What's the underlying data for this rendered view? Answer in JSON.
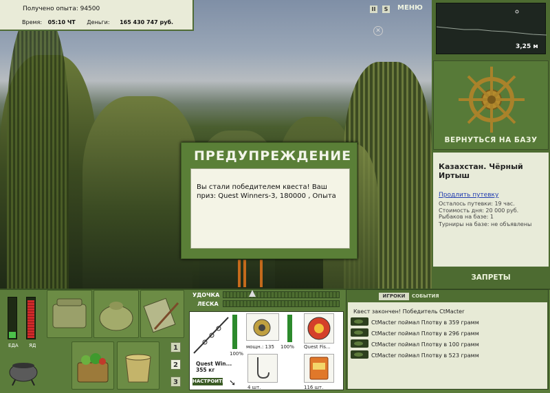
{
  "hud": {
    "experience_text": "Получено опыта: 94500",
    "time_label": "Время:",
    "time_value": "05:10 ЧТ",
    "money_label": "Деньги:",
    "money_value": "165 430 747 руб.",
    "pause_btn": "II",
    "speed_btn": "S",
    "menu_btn": "МЕНЮ"
  },
  "depth": {
    "value": "3,25 м"
  },
  "base": {
    "return_label": "ВЕРНУТЬСЯ НА БАЗУ",
    "location": "Казахстан. Чёрный Иртыш",
    "extend_link": "Продлить путевку",
    "remaining": "Осталось путевки: 19 час.",
    "cost": "Стоимость дня: 20 000 руб.",
    "fishers": "Рыбаков на базе: 1",
    "tournaments": "Турниры на базе: не объявлены",
    "bans_label": "ЗАПРЕТЫ"
  },
  "dialog": {
    "title": "ПРЕДУПРЕЖДЕНИЕ",
    "message": "Вы стали победителем квеста! Ваш приз: Quest Winners-3, 180000 , Опыта"
  },
  "gauges": {
    "food_label": "ЕДА",
    "poison_label": "ЯД",
    "food_level": 0.15,
    "poison_level": 0.95
  },
  "tackle": {
    "rod_label": "УДОЧКА",
    "line_label": "ЛЕСКА",
    "rod_name": "Quest Win...",
    "rod_weight": "355 кг",
    "rod_pct": "100%",
    "reel_text": "мощн.: 135",
    "reel_pct": "100%",
    "line_name": "Quest Fis...",
    "hook_count": "4 шт.",
    "bait_count": "116 шт.",
    "setup_btn": "НАСТРОИТЬ"
  },
  "slots": [
    "1",
    "2",
    "3"
  ],
  "events": {
    "tab_players": "ИГРОКИ",
    "tab_events": "СОБЫТИЯ",
    "lines": [
      "Квест закончен! Победитель CtMacter",
      "CtMacter поймал Плотву в 359 грамм",
      "CtMacter поймал Плотву в 296 грамм",
      "CtMacter поймал Плотву в 100 грамм",
      "CtMacter поймал Плотву в 523 грамм"
    ]
  }
}
